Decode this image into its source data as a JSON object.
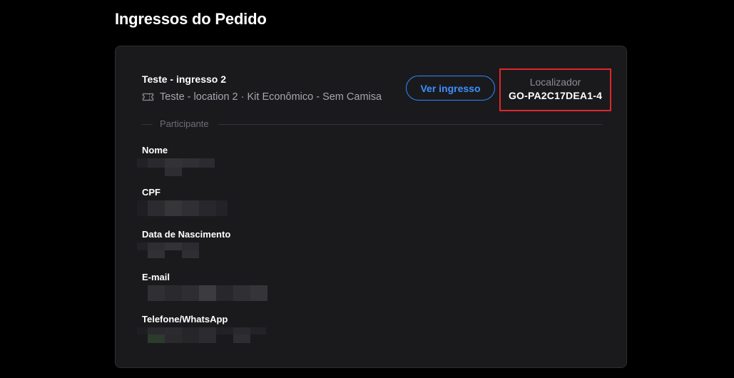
{
  "page_title": "Ingressos do Pedido",
  "ticket": {
    "name": "Teste - ingresso 2",
    "details": "Teste - location 2 · Kit Econômico - Sem Camisa",
    "icon": "ticket-icon",
    "view_button_label": "Ver ingresso"
  },
  "locator": {
    "label": "Localizador",
    "code": "GO-PA2C17DEA1-4"
  },
  "participant": {
    "section_label": "Participante",
    "fields": [
      {
        "label": "Nome"
      },
      {
        "label": "CPF"
      },
      {
        "label": "Data de Nascimento"
      },
      {
        "label": "E-mail"
      },
      {
        "label": "Telefone/WhatsApp"
      }
    ]
  },
  "colors": {
    "background": "#000000",
    "card": "#1a1a1d",
    "accent": "#3b91ff",
    "highlight_border": "#e0262b"
  }
}
